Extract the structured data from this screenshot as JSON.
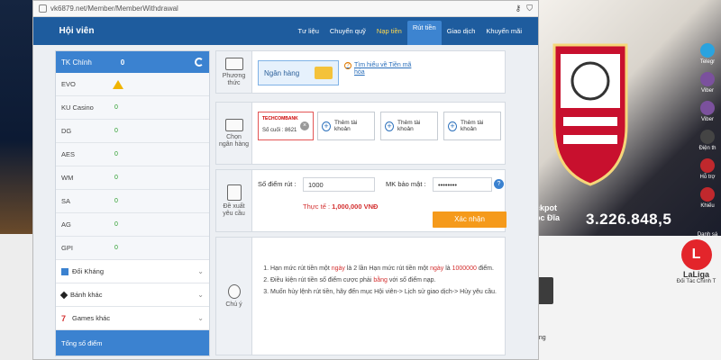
{
  "browser": {
    "url": "vk6879.net/Member/MemberWithdrawal"
  },
  "header": {
    "title": "Hội viên",
    "tabs": [
      {
        "label": "Tư liệu"
      },
      {
        "label": "Chuyển quỹ"
      },
      {
        "label": "Nạp tiền"
      },
      {
        "label": "Rút tiền"
      },
      {
        "label": "Giao dịch"
      },
      {
        "label": "Khuyến mãi"
      }
    ]
  },
  "account": {
    "main_label": "TK Chính",
    "main_value": "0",
    "wallets": [
      {
        "name": "EVO",
        "value": ""
      },
      {
        "name": "KU Casino",
        "value": "0"
      },
      {
        "name": "DG",
        "value": "0"
      },
      {
        "name": "AES",
        "value": "0"
      },
      {
        "name": "WM",
        "value": "0"
      },
      {
        "name": "SA",
        "value": "0"
      },
      {
        "name": "AG",
        "value": "0"
      },
      {
        "name": "GPI",
        "value": "0"
      }
    ],
    "groups": [
      {
        "label": "Đối Kháng"
      },
      {
        "label": "Bánh khác"
      },
      {
        "label": "Games khác"
      }
    ],
    "total_label": "Tổng số điểm"
  },
  "method": {
    "label_line1": "Phương",
    "label_line2": "thức",
    "option": "Ngân hàng",
    "info_line1": "Tìm hiểu về Tiền mã",
    "info_line2": "hóa"
  },
  "bank": {
    "label_line1": "Chọn",
    "label_line2": "ngân hàng",
    "selected_logo": "TECHCOMBANK",
    "selected_number": "Số cuối : 8621",
    "add_label": "Thêm tài khoản"
  },
  "withdraw": {
    "label_line1": "Đề xuất",
    "label_line2": "yêu cầu",
    "points_label": "Số điểm rút :",
    "points_value": "1000",
    "password_label": "MK bảo mật :",
    "password_value": "••••••••",
    "real_label": "Thực tế :",
    "real_value": "1,000,000 VNĐ",
    "confirm_label": "Xác nhận"
  },
  "notes": {
    "label": "Chú ý",
    "items": [
      {
        "pre": "Hạn mức rút tiền một ",
        "hl1": "ngày",
        "mid": " là 2 lần Hạn mức rút tiền một ",
        "hl2": "ngày",
        "mid2": " là ",
        "hl3": "1000000",
        "post": " điểm."
      },
      {
        "pre": "Điều kiện rút tiền số điểm cược phải ",
        "hl1": "bằng",
        "post": " với số điểm nạp."
      },
      {
        "text": "Muốn hủy lệnh rút tiền, hãy đến mục Hội viên-> Lịch sử giao dịch-> Hủy yêu cầu."
      }
    ]
  },
  "background": {
    "promo_line1": "ckpot",
    "promo_line2": "ọc Đĩa",
    "promo_amount": "3.226.848,5",
    "side_menu": [
      "Telegr",
      "Viber",
      "Viber",
      "Điện th",
      "Hỗ trợ",
      "Khiếu",
      "Danh sá"
    ],
    "laliga_name": "LaLiga",
    "laliga_sub": "Đối Tác Chính T",
    "bottom_text": "ông"
  },
  "colors": {
    "header_blue": "#1e5c9e",
    "accent_blue": "#3b82d0",
    "confirm_orange": "#f59a1b",
    "highlight_red": "#d32f2f"
  }
}
